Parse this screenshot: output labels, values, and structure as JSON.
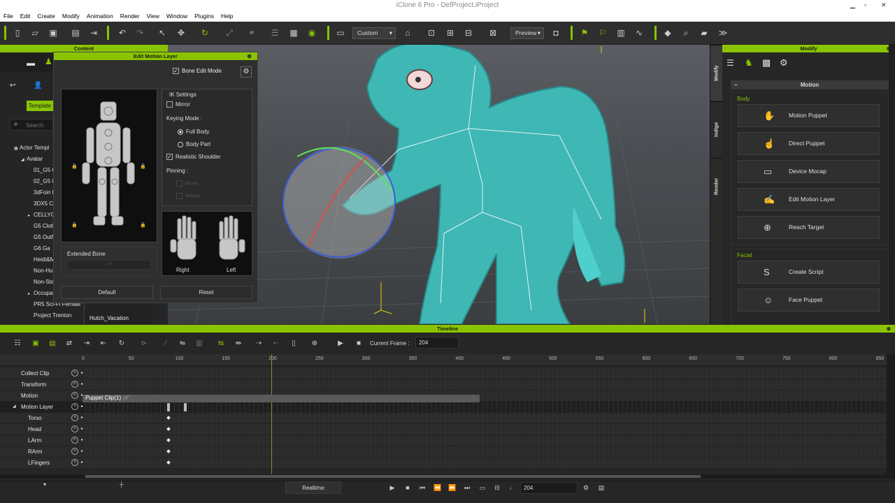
{
  "window": {
    "title": "iClone 6 Pro - DefProject.iProject"
  },
  "menu": [
    "File",
    "Edit",
    "Create",
    "Modify",
    "Animation",
    "Render",
    "View",
    "Window",
    "Plugins",
    "Help"
  ],
  "toolbar": {
    "camera_select": "Custom",
    "preview_select": "Preview"
  },
  "content_panel": {
    "title": "Content",
    "tab": "Template",
    "search_placeholder": "Search",
    "tree": [
      {
        "label": "Actor Templ",
        "indent": 0,
        "expander": "▦"
      },
      {
        "label": "Avatar",
        "indent": 1,
        "expander": "◢"
      },
      {
        "label": "01_G5 C",
        "indent": 2,
        "expander": ""
      },
      {
        "label": "02_G5 C",
        "indent": 2,
        "expander": ""
      },
      {
        "label": "3dFoin F",
        "indent": 2,
        "expander": ""
      },
      {
        "label": "3DX5 Cl",
        "indent": 2,
        "expander": ""
      },
      {
        "label": "CELLYG",
        "indent": 2,
        "expander": "▸"
      },
      {
        "label": "G5 Cloth",
        "indent": 2,
        "expander": ""
      },
      {
        "label": "G5 Outfi",
        "indent": 2,
        "expander": ""
      },
      {
        "label": "G6 Ga",
        "indent": 2,
        "expander": ""
      },
      {
        "label": "Heidi&M",
        "indent": 2,
        "expander": ""
      },
      {
        "label": "Non-Hu",
        "indent": 2,
        "expander": ""
      },
      {
        "label": "Non-Sta",
        "indent": 2,
        "expander": ""
      },
      {
        "label": "Occupat",
        "indent": 2,
        "expander": "▸"
      },
      {
        "label": "PR5 Sci-Fi Female",
        "indent": 2,
        "expander": ""
      },
      {
        "label": "Project Trenton",
        "indent": 2,
        "expander": ""
      }
    ],
    "item_label": "Hutch_Vacation"
  },
  "edit_motion_layer": {
    "title": "Edit Motion Layer",
    "bone_edit_mode": "Bone Edit Mode",
    "ik_settings": "IK Settings",
    "mirror": "Mirror",
    "keying_mode": "Keying Mode :",
    "full_body": "Full Body",
    "body_part": "Body Part",
    "realistic_shoulder": "Realistic Shoulder",
    "pinning": "Pinning :",
    "pin_move": "Move",
    "pin_rotate": "Rotate",
    "extended_bone": "Extended Bone",
    "extended_value": "Off",
    "right": "Right",
    "left": "Left",
    "default_btn": "Default",
    "reset_btn": "Reset"
  },
  "modify": {
    "title": "Modify",
    "section": "Motion",
    "body_label": "Body",
    "facial_label": "Facial",
    "body_buttons": [
      {
        "label": "Motion Puppet",
        "icon": "motion-puppet-icon",
        "glyph": "✋"
      },
      {
        "label": "Direct Puppet",
        "icon": "direct-puppet-icon",
        "glyph": "☝"
      },
      {
        "label": "Device Mocap",
        "icon": "device-mocap-icon",
        "glyph": "▭"
      },
      {
        "label": "Edit Motion Layer",
        "icon": "edit-motion-layer-icon",
        "glyph": "✍"
      },
      {
        "label": "Reach Target",
        "icon": "reach-target-icon",
        "glyph": "⊕"
      }
    ],
    "facial_buttons": [
      {
        "label": "Create Script",
        "icon": "create-script-icon",
        "glyph": "S"
      },
      {
        "label": "Face Puppet",
        "icon": "face-puppet-icon",
        "glyph": "☺"
      }
    ]
  },
  "side_tabs": [
    "Modify",
    "Indigo",
    "Render"
  ],
  "timeline": {
    "title": "Timeline",
    "current_frame_label": "Current Frame :",
    "current_frame": "204",
    "ruler": [
      "0",
      "50",
      "100",
      "150",
      "200",
      "250",
      "300",
      "350",
      "400",
      "450",
      "500",
      "550",
      "600",
      "650",
      "700",
      "750",
      "800",
      "850"
    ],
    "rows": [
      {
        "name": "Collect Clip",
        "expander": ""
      },
      {
        "name": "Transform",
        "expander": ""
      },
      {
        "name": "Motion",
        "expander": ""
      },
      {
        "name": "Motion Layer",
        "expander": "◢"
      },
      {
        "name": "Torso",
        "expander": ""
      },
      {
        "name": "Head",
        "expander": ""
      },
      {
        "name": "LArm",
        "expander": ""
      },
      {
        "name": "RArm",
        "expander": ""
      },
      {
        "name": "LFingers",
        "expander": ""
      }
    ],
    "clip_label": "Puppet Clip(1)"
  },
  "playback": {
    "realtime": "Realtime",
    "frame": "204"
  },
  "colors": {
    "accent": "#8ac400"
  }
}
